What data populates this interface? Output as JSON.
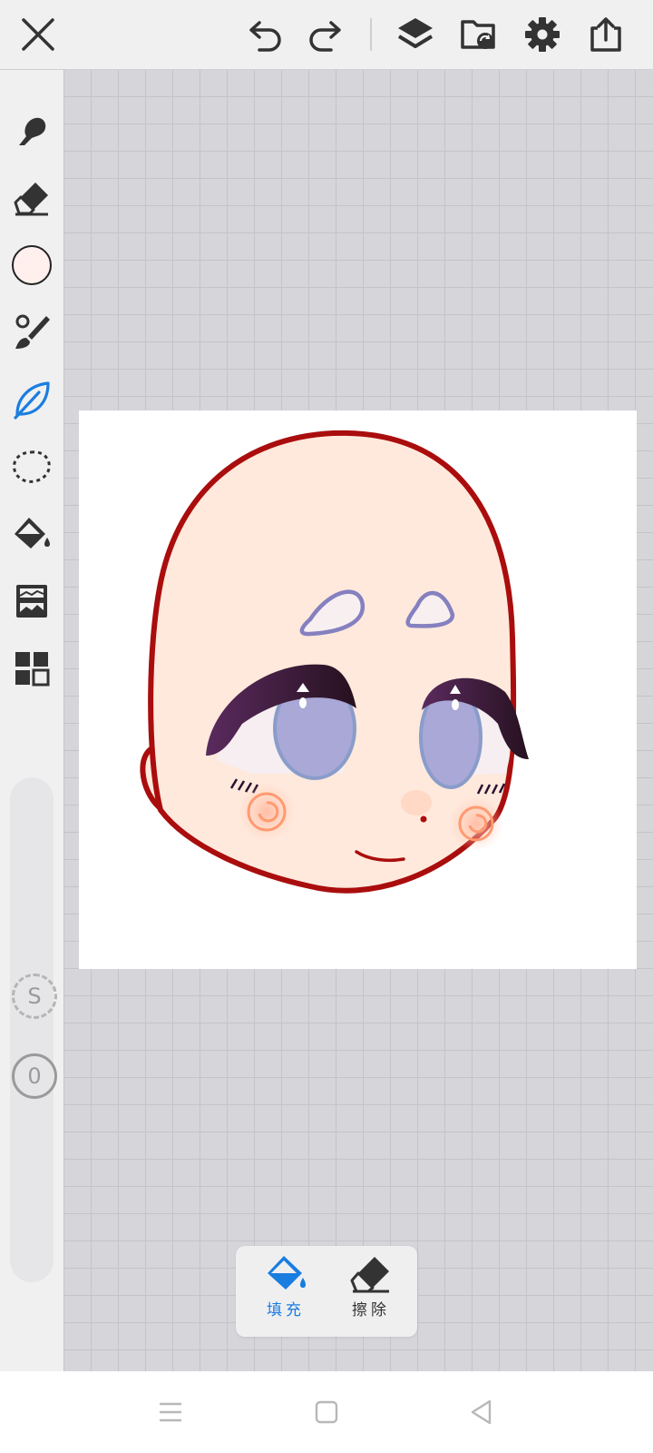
{
  "toolbar": {
    "items": [
      "close",
      "undo",
      "redo",
      "layers",
      "file",
      "settings",
      "share"
    ]
  },
  "sidebar": {
    "tools": [
      "smudge",
      "eraser",
      "color",
      "brush",
      "airbrush",
      "lasso",
      "fill",
      "filter",
      "grid-layout"
    ],
    "selected_tool": "airbrush",
    "current_color": "#fff0ee",
    "size_label": "S",
    "opacity_value": "0"
  },
  "fill_panel": {
    "fill_label": "填充",
    "erase_label": "擦除",
    "selected": "fill"
  },
  "colors": {
    "accent": "#1a7de0",
    "outline": "#aa0d0d",
    "skin": "#ffe9dc",
    "iris": "#a9a8d6",
    "lash": "#3e1a40"
  }
}
